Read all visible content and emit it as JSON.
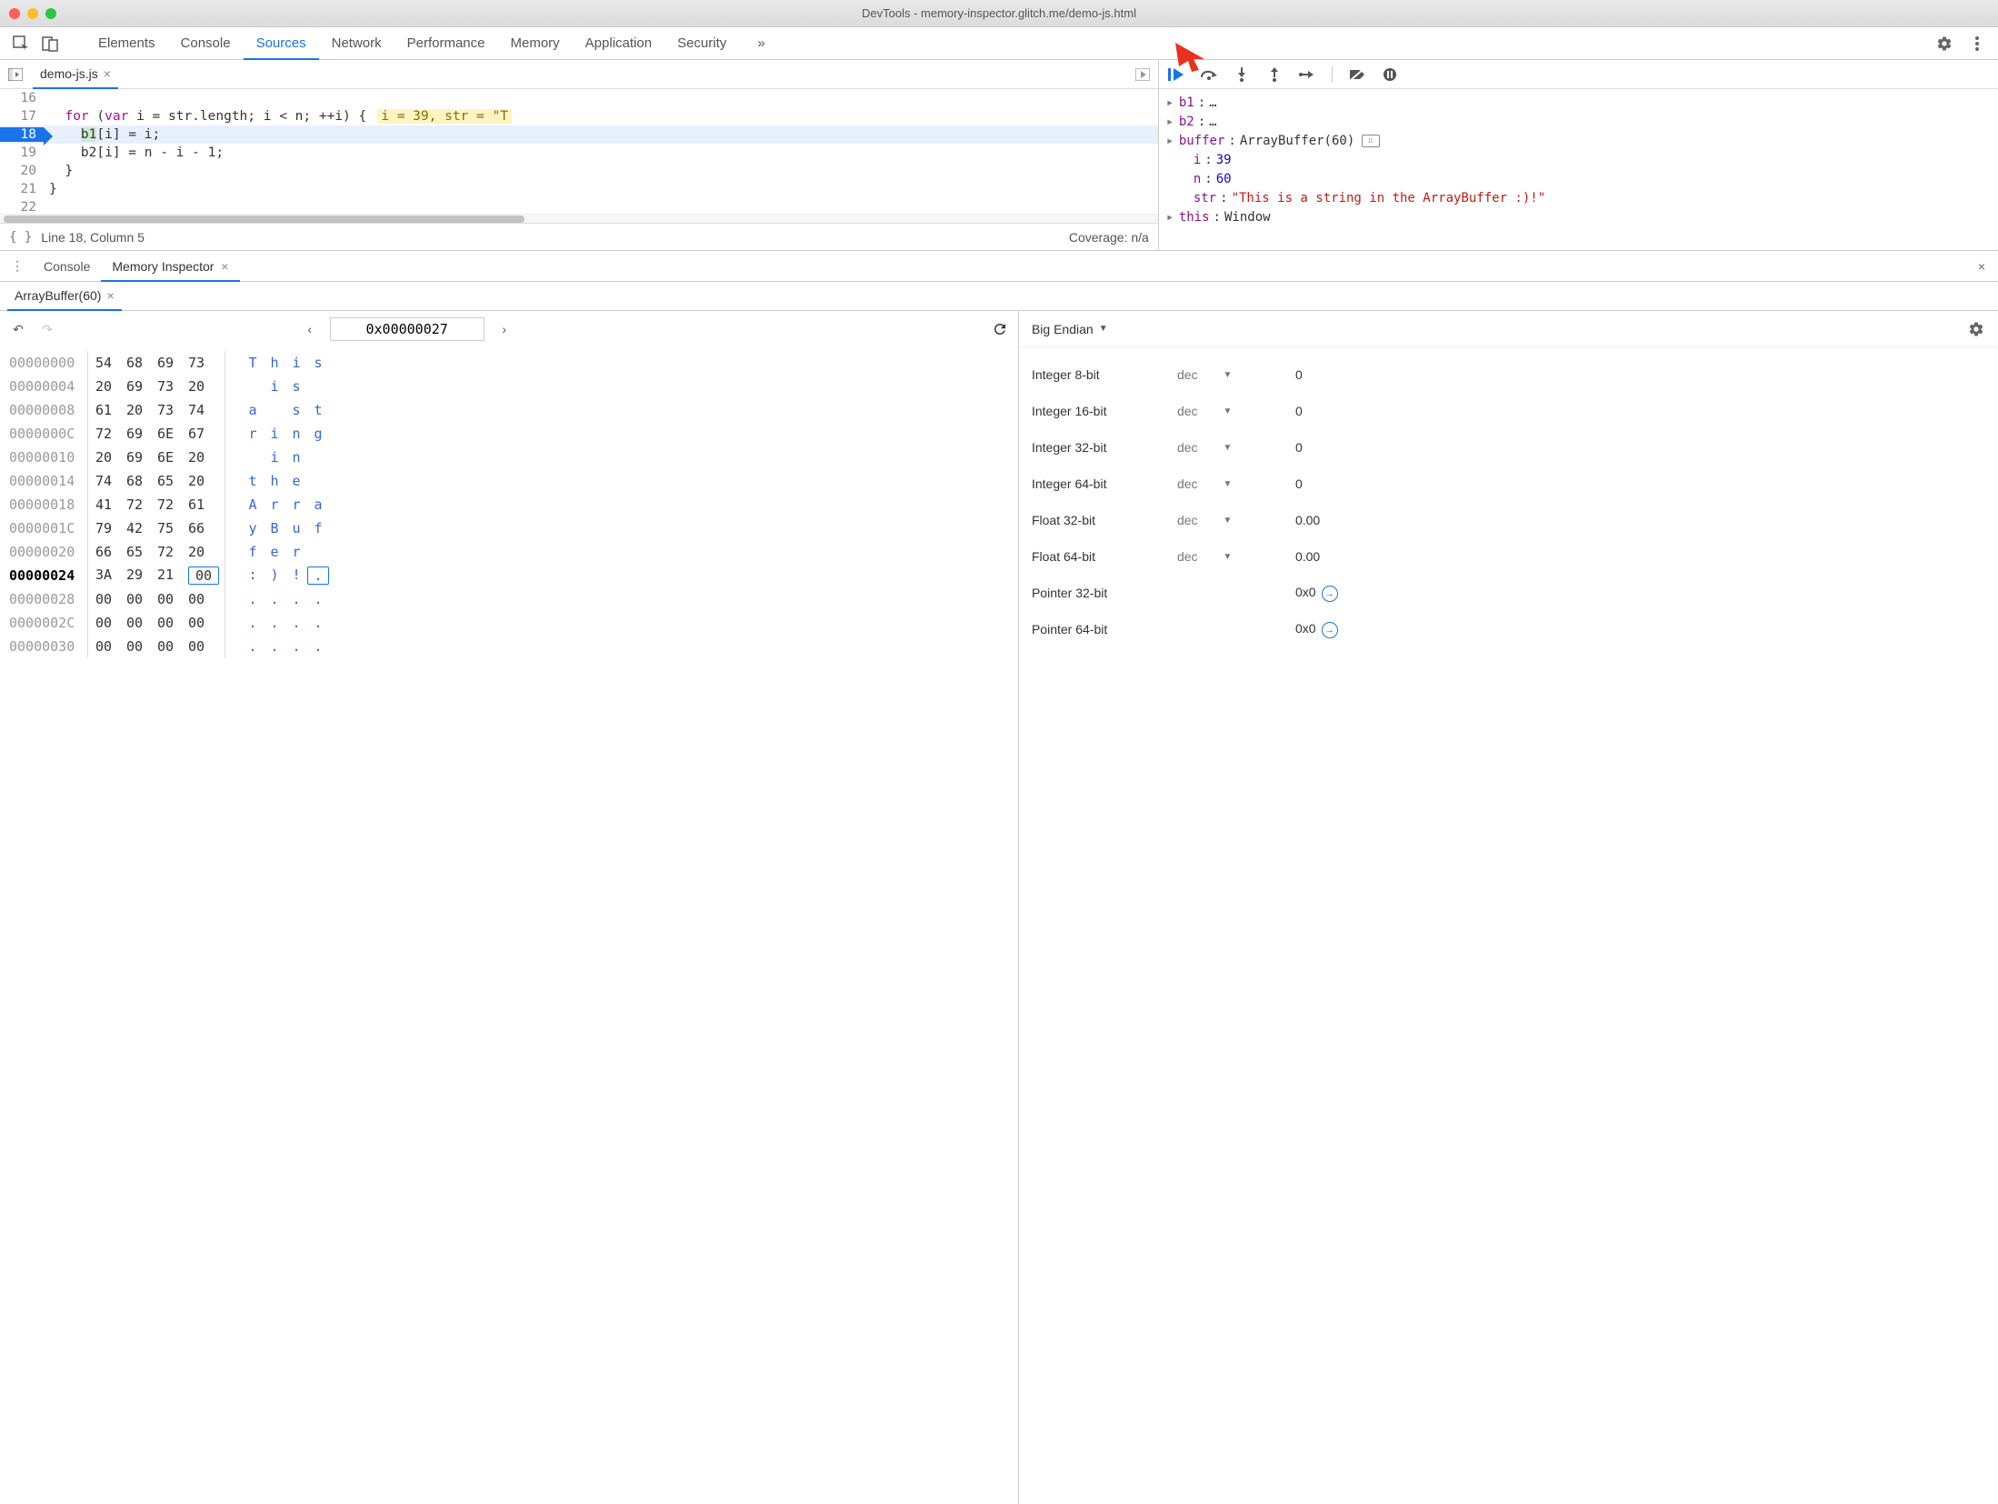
{
  "window": {
    "title": "DevTools - memory-inspector.glitch.me/demo-js.html"
  },
  "mainTabs": {
    "items": [
      "Elements",
      "Console",
      "Sources",
      "Network",
      "Performance",
      "Memory",
      "Application",
      "Security"
    ],
    "activeIndex": 2
  },
  "sources": {
    "file": {
      "name": "demo-js.js"
    },
    "code": {
      "lines": [
        {
          "n": 16,
          "text": ""
        },
        {
          "n": 17,
          "text": "  for (var i = str.length; i < n; ++i) {",
          "tokens": [
            {
              "t": "  ",
              "cls": ""
            },
            {
              "t": "for",
              "cls": "cl-kw"
            },
            {
              "t": " (",
              "cls": ""
            },
            {
              "t": "var",
              "cls": "cl-kw"
            },
            {
              "t": " i = str.length; i < n; ++i) {",
              "cls": ""
            }
          ],
          "hint": "i = 39, str = \"T"
        },
        {
          "n": 18,
          "text": "    b1[i] = i;",
          "breakpoint": true,
          "current": true,
          "tokens": [
            {
              "t": "    b1[i] = i;",
              "cls": ""
            }
          ]
        },
        {
          "n": 19,
          "text": "    b2[i] = n - i - 1;",
          "tokens": [
            {
              "t": "    b2[i] = n - i - 1;",
              "cls": ""
            }
          ]
        },
        {
          "n": 20,
          "text": "  }",
          "tokens": [
            {
              "t": "  }",
              "cls": ""
            }
          ]
        },
        {
          "n": 21,
          "text": "}",
          "tokens": [
            {
              "t": "}",
              "cls": ""
            }
          ]
        },
        {
          "n": 22,
          "text": "",
          "tokens": []
        }
      ]
    },
    "status": {
      "cursor": "Line 18, Column 5",
      "coverage": "Coverage: n/a"
    }
  },
  "scope": {
    "rows": [
      {
        "kind": "obj",
        "key": "b1",
        "val": "…"
      },
      {
        "kind": "obj",
        "key": "b2",
        "val": "…"
      },
      {
        "kind": "obj",
        "key": "buffer",
        "val": "ArrayBuffer(60)",
        "memicon": true
      },
      {
        "kind": "num",
        "key": "i",
        "val": "39",
        "indent": true
      },
      {
        "kind": "num",
        "key": "n",
        "val": "60",
        "indent": true
      },
      {
        "kind": "str",
        "key": "str",
        "val": "\"This is a string in the ArrayBuffer :)!\"",
        "indent": true
      },
      {
        "kind": "obj",
        "key": "this",
        "val": "Window"
      }
    ]
  },
  "drawer": {
    "tabs": {
      "items": [
        "Console",
        "Memory Inspector"
      ],
      "activeIndex": 1
    },
    "inspector": {
      "bufferTab": "ArrayBuffer(60)",
      "address": "0x00000027",
      "rows": [
        {
          "addr": "00000000",
          "bytes": [
            "54",
            "68",
            "69",
            "73"
          ],
          "ascii": [
            "T",
            "h",
            "i",
            "s"
          ]
        },
        {
          "addr": "00000004",
          "bytes": [
            "20",
            "69",
            "73",
            "20"
          ],
          "ascii": [
            " ",
            "i",
            "s",
            " "
          ]
        },
        {
          "addr": "00000008",
          "bytes": [
            "61",
            "20",
            "73",
            "74"
          ],
          "ascii": [
            "a",
            " ",
            "s",
            "t"
          ]
        },
        {
          "addr": "0000000C",
          "bytes": [
            "72",
            "69",
            "6E",
            "67"
          ],
          "ascii": [
            "r",
            "i",
            "n",
            "g"
          ]
        },
        {
          "addr": "00000010",
          "bytes": [
            "20",
            "69",
            "6E",
            "20"
          ],
          "ascii": [
            " ",
            "i",
            "n",
            " "
          ]
        },
        {
          "addr": "00000014",
          "bytes": [
            "74",
            "68",
            "65",
            "20"
          ],
          "ascii": [
            "t",
            "h",
            "e",
            " "
          ]
        },
        {
          "addr": "00000018",
          "bytes": [
            "41",
            "72",
            "72",
            "61"
          ],
          "ascii": [
            "A",
            "r",
            "r",
            "a"
          ]
        },
        {
          "addr": "0000001C",
          "bytes": [
            "79",
            "42",
            "75",
            "66"
          ],
          "ascii": [
            "y",
            "B",
            "u",
            "f"
          ]
        },
        {
          "addr": "00000020",
          "bytes": [
            "66",
            "65",
            "72",
            "20"
          ],
          "ascii": [
            "f",
            "e",
            "r",
            " "
          ]
        },
        {
          "addr": "00000024",
          "bytes": [
            "3A",
            "29",
            "21",
            "00"
          ],
          "ascii": [
            ":",
            ")",
            "!",
            "."
          ],
          "curByte": 3,
          "current": true
        },
        {
          "addr": "00000028",
          "bytes": [
            "00",
            "00",
            "00",
            "00"
          ],
          "ascii": [
            ".",
            ".",
            ".",
            "."
          ]
        },
        {
          "addr": "0000002C",
          "bytes": [
            "00",
            "00",
            "00",
            "00"
          ],
          "ascii": [
            ".",
            ".",
            ".",
            "."
          ]
        },
        {
          "addr": "00000030",
          "bytes": [
            "00",
            "00",
            "00",
            "00"
          ],
          "ascii": [
            ".",
            ".",
            ".",
            "."
          ]
        }
      ],
      "endian": "Big Endian",
      "values": [
        {
          "label": "Integer 8-bit",
          "fmt": "dec",
          "val": "0"
        },
        {
          "label": "Integer 16-bit",
          "fmt": "dec",
          "val": "0"
        },
        {
          "label": "Integer 32-bit",
          "fmt": "dec",
          "val": "0"
        },
        {
          "label": "Integer 64-bit",
          "fmt": "dec",
          "val": "0"
        },
        {
          "label": "Float 32-bit",
          "fmt": "dec",
          "val": "0.00"
        },
        {
          "label": "Float 64-bit",
          "fmt": "dec",
          "val": "0.00"
        },
        {
          "label": "Pointer 32-bit",
          "fmt": "",
          "val": "0x0",
          "jump": true
        },
        {
          "label": "Pointer 64-bit",
          "fmt": "",
          "val": "0x0",
          "jump": true
        }
      ]
    }
  }
}
